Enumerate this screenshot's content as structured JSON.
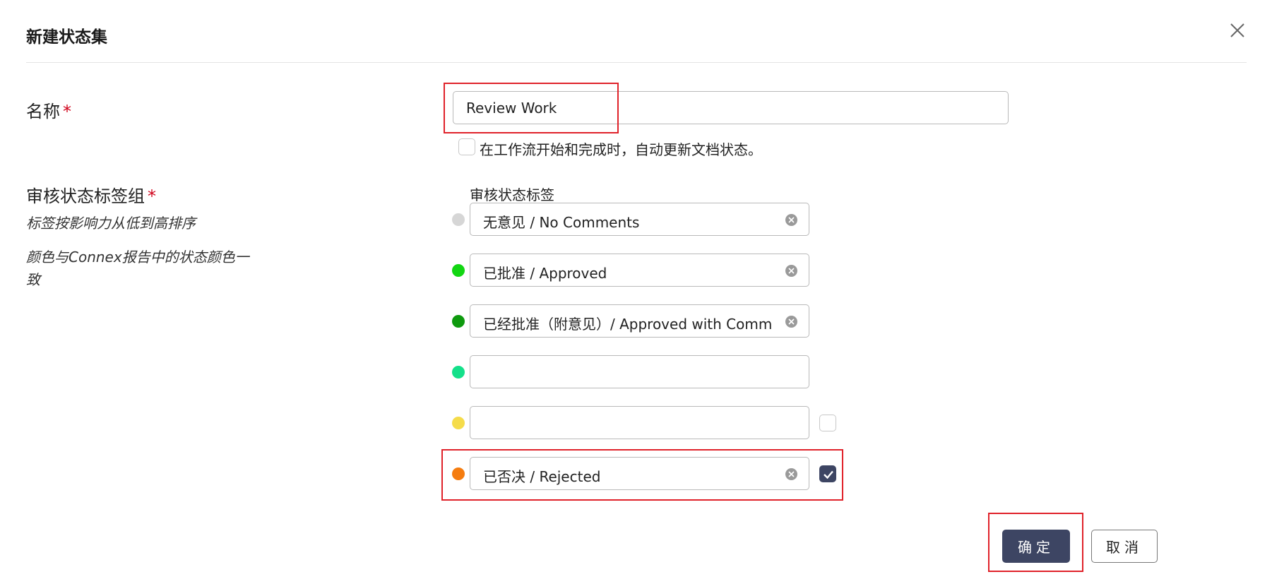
{
  "dialog": {
    "title": "新建状态集"
  },
  "name_field": {
    "label": "名称",
    "required_mark": "*",
    "value": "Review Work"
  },
  "auto_update": {
    "label": "在工作流开始和完成时，自动更新文档状态。",
    "checked": false
  },
  "tag_group": {
    "label": "审核状态标签组",
    "required_mark": "*",
    "hint_order": "标签按影响力从低到高排序",
    "hint_color": "颜色与Connex报告中的状态颜色一致",
    "column_header": "审核状态标签",
    "tags": [
      {
        "text": "无意见 / No Comments",
        "color": "#d6d6d6",
        "has_clear": true
      },
      {
        "text": "已批准 / Approved",
        "color": "#12d612",
        "has_clear": true
      },
      {
        "text": "已经批准（附意见）/ Approved with Comments",
        "color": "#0e9a0e",
        "has_clear": true
      },
      {
        "text": "",
        "color": "#14e08a",
        "has_clear": false
      },
      {
        "text": "",
        "color": "#f5dc4a",
        "has_clear": false,
        "checkbox": false
      },
      {
        "text": "已否决 / Rejected",
        "color": "#f57c0f",
        "has_clear": true,
        "checkbox": true
      }
    ]
  },
  "actions": {
    "ok_label": "确定",
    "cancel_label": "取消"
  },
  "colors": {
    "primary": "#3d4563",
    "highlight": "#e0222a",
    "required": "#d0021b"
  }
}
